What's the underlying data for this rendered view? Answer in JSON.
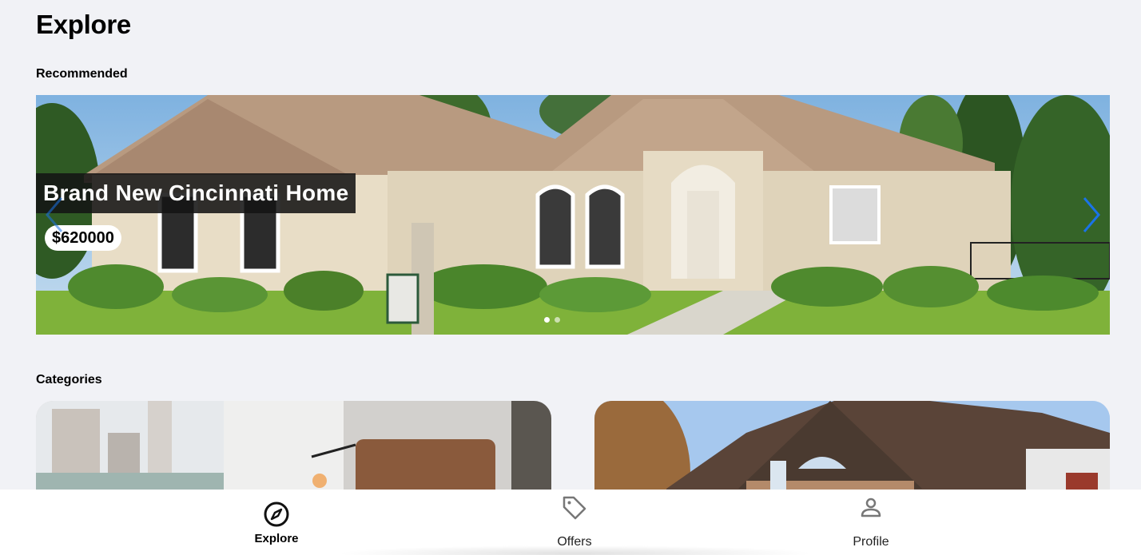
{
  "page": {
    "title": "Explore"
  },
  "recommended": {
    "section_label": "Recommended",
    "slide": {
      "title": "Brand New Cincinnati Home",
      "price": "$620000",
      "image": "house-photo"
    },
    "prev_icon": "chevron-left-icon",
    "next_icon": "chevron-right-icon",
    "accent_color": "#1a73e8"
  },
  "categories": {
    "section_label": "Categories",
    "cards": [
      {
        "image": "apartment-interior-photo"
      },
      {
        "image": "house-exterior-photo"
      }
    ]
  },
  "bottom_nav": {
    "items": [
      {
        "label": "Explore",
        "icon": "compass-icon",
        "active": true
      },
      {
        "label": "Offers",
        "icon": "tag-icon",
        "active": false
      },
      {
        "label": "Profile",
        "icon": "person-icon",
        "active": false
      }
    ]
  }
}
